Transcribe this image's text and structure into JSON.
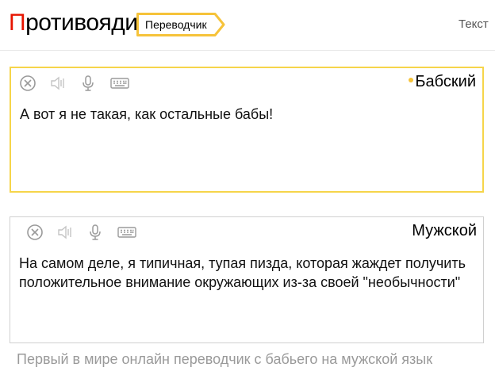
{
  "header": {
    "logo_first": "П",
    "logo_rest": "ротивоядие",
    "service_label": "Переводчик",
    "tab_text": "Текст"
  },
  "source": {
    "language": "Бабский",
    "text": "А вот я не такая, как остальные бабы!",
    "icons": [
      "clear-icon",
      "speaker-icon",
      "microphone-icon",
      "keyboard-icon"
    ]
  },
  "target": {
    "language": "Мужской",
    "text": "На самом деле, я типичная, тупая пизда, которая жаждет получить положительное внимание окружающих из-за своей \"необычности\"",
    "icons": [
      "clear-icon",
      "speaker-icon",
      "microphone-icon",
      "keyboard-icon"
    ]
  },
  "footer": {
    "tagline": "Первый в мире онлайн переводчик с бабьего на мужской язык"
  },
  "colors": {
    "logo_accent": "#e61400",
    "focus_border": "#f6d54a",
    "muted_text": "#9a9a9a"
  }
}
